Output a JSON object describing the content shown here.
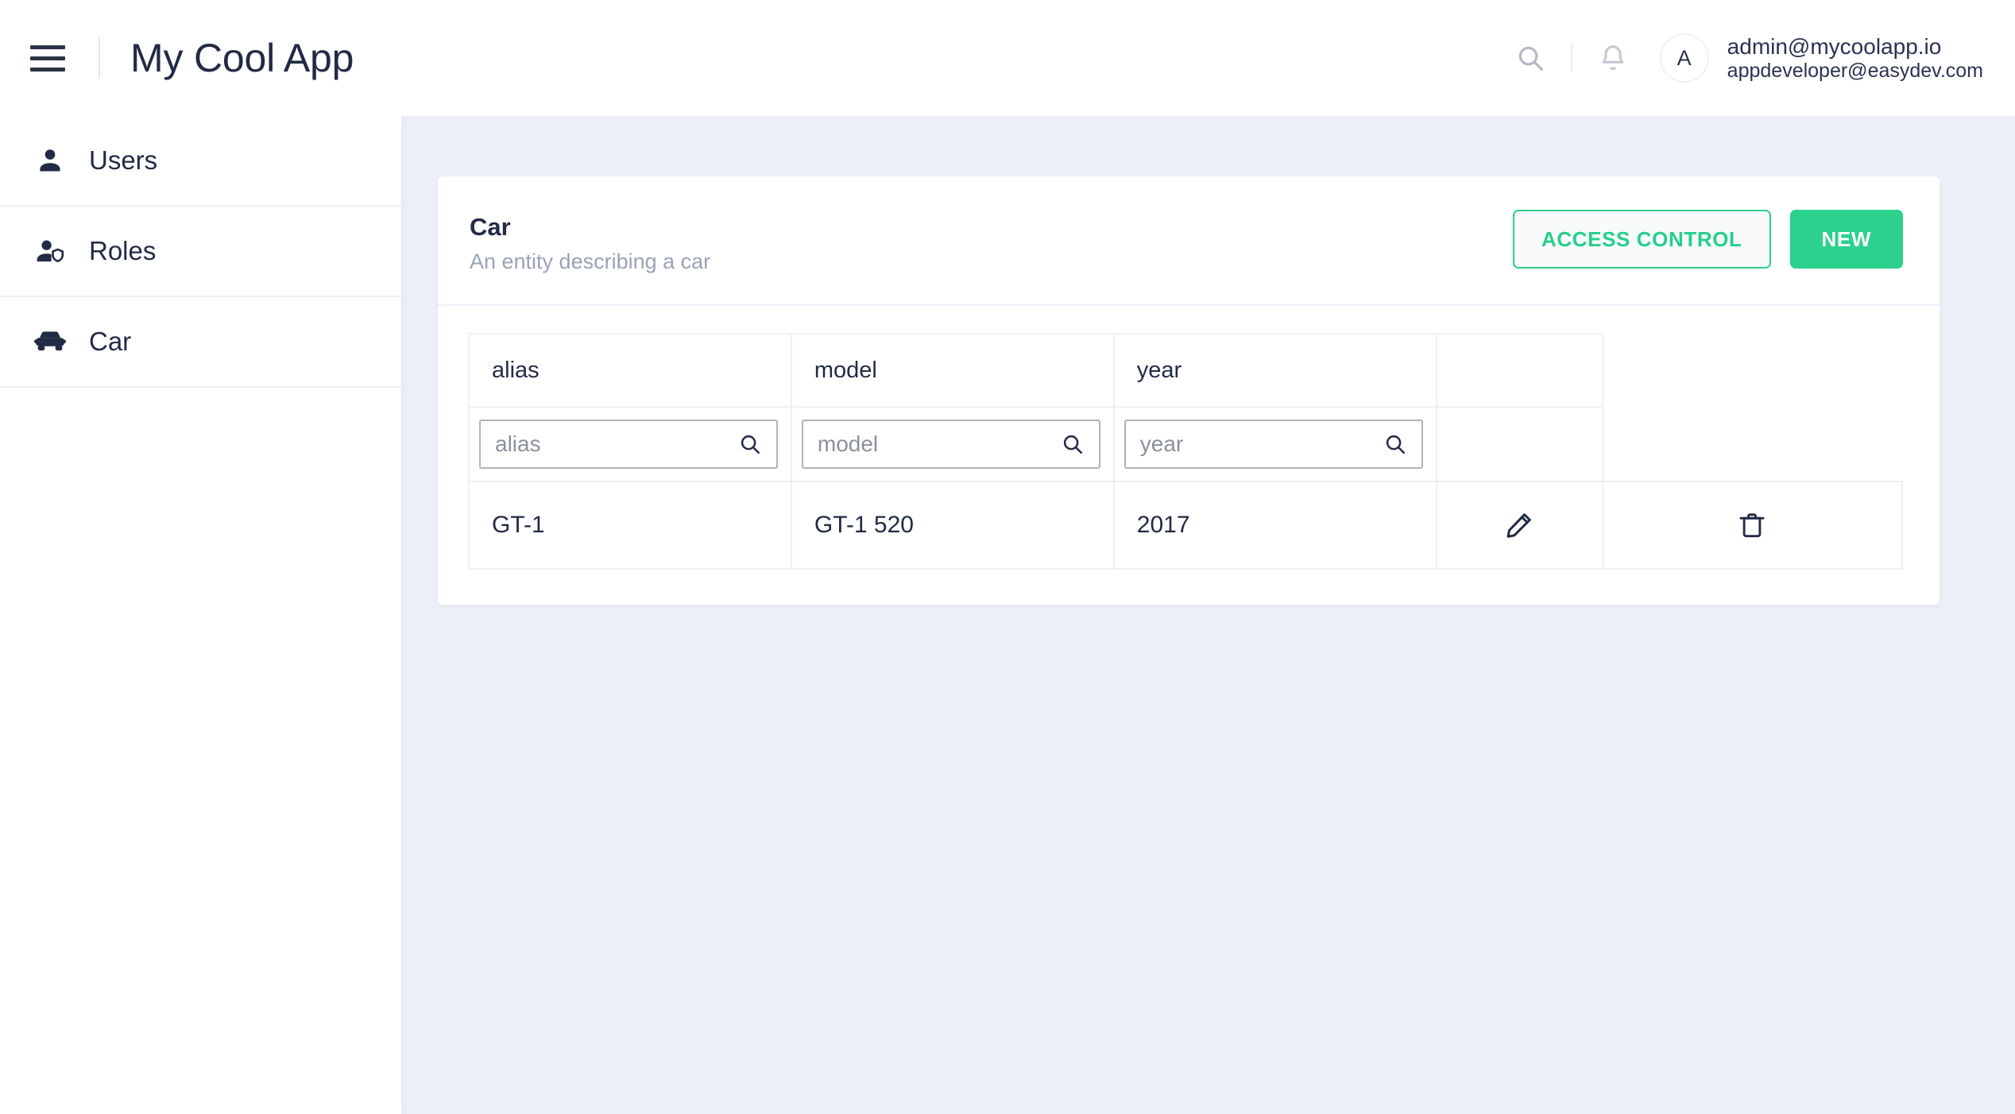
{
  "header": {
    "menu_icon": "hamburger-icon",
    "app_title": "My Cool App",
    "search_icon": "search-icon",
    "bell_icon": "bell-icon",
    "avatar_initial": "A",
    "user_email": "admin@mycoolapp.io",
    "user_sub": "appdeveloper@easydev.com"
  },
  "sidebar": {
    "items": [
      {
        "label": "Users",
        "icon": "user-icon"
      },
      {
        "label": "Roles",
        "icon": "user-shield-icon"
      },
      {
        "label": "Car",
        "icon": "car-icon"
      }
    ]
  },
  "card": {
    "title": "Car",
    "subtitle": "An entity describing a car",
    "access_control_label": "ACCESS CONTROL",
    "new_label": "NEW"
  },
  "table": {
    "columns": [
      {
        "header": "alias",
        "filter_placeholder": "alias",
        "filter_value": ""
      },
      {
        "header": "model",
        "filter_placeholder": "model",
        "filter_value": ""
      },
      {
        "header": "year",
        "filter_placeholder": "year",
        "filter_value": ""
      }
    ],
    "rows": [
      {
        "alias": "GT-1",
        "model": "GT-1 520",
        "year": "2017"
      }
    ],
    "row_actions": {
      "edit_icon": "pencil-icon",
      "delete_icon": "trash-icon"
    }
  },
  "colors": {
    "accent_green": "#2bd18c",
    "accent_green_text": "#25cf89",
    "text_dark": "#222b45",
    "muted": "#9aa3b5",
    "content_bg": "#eceff7",
    "border": "#eceff6"
  }
}
